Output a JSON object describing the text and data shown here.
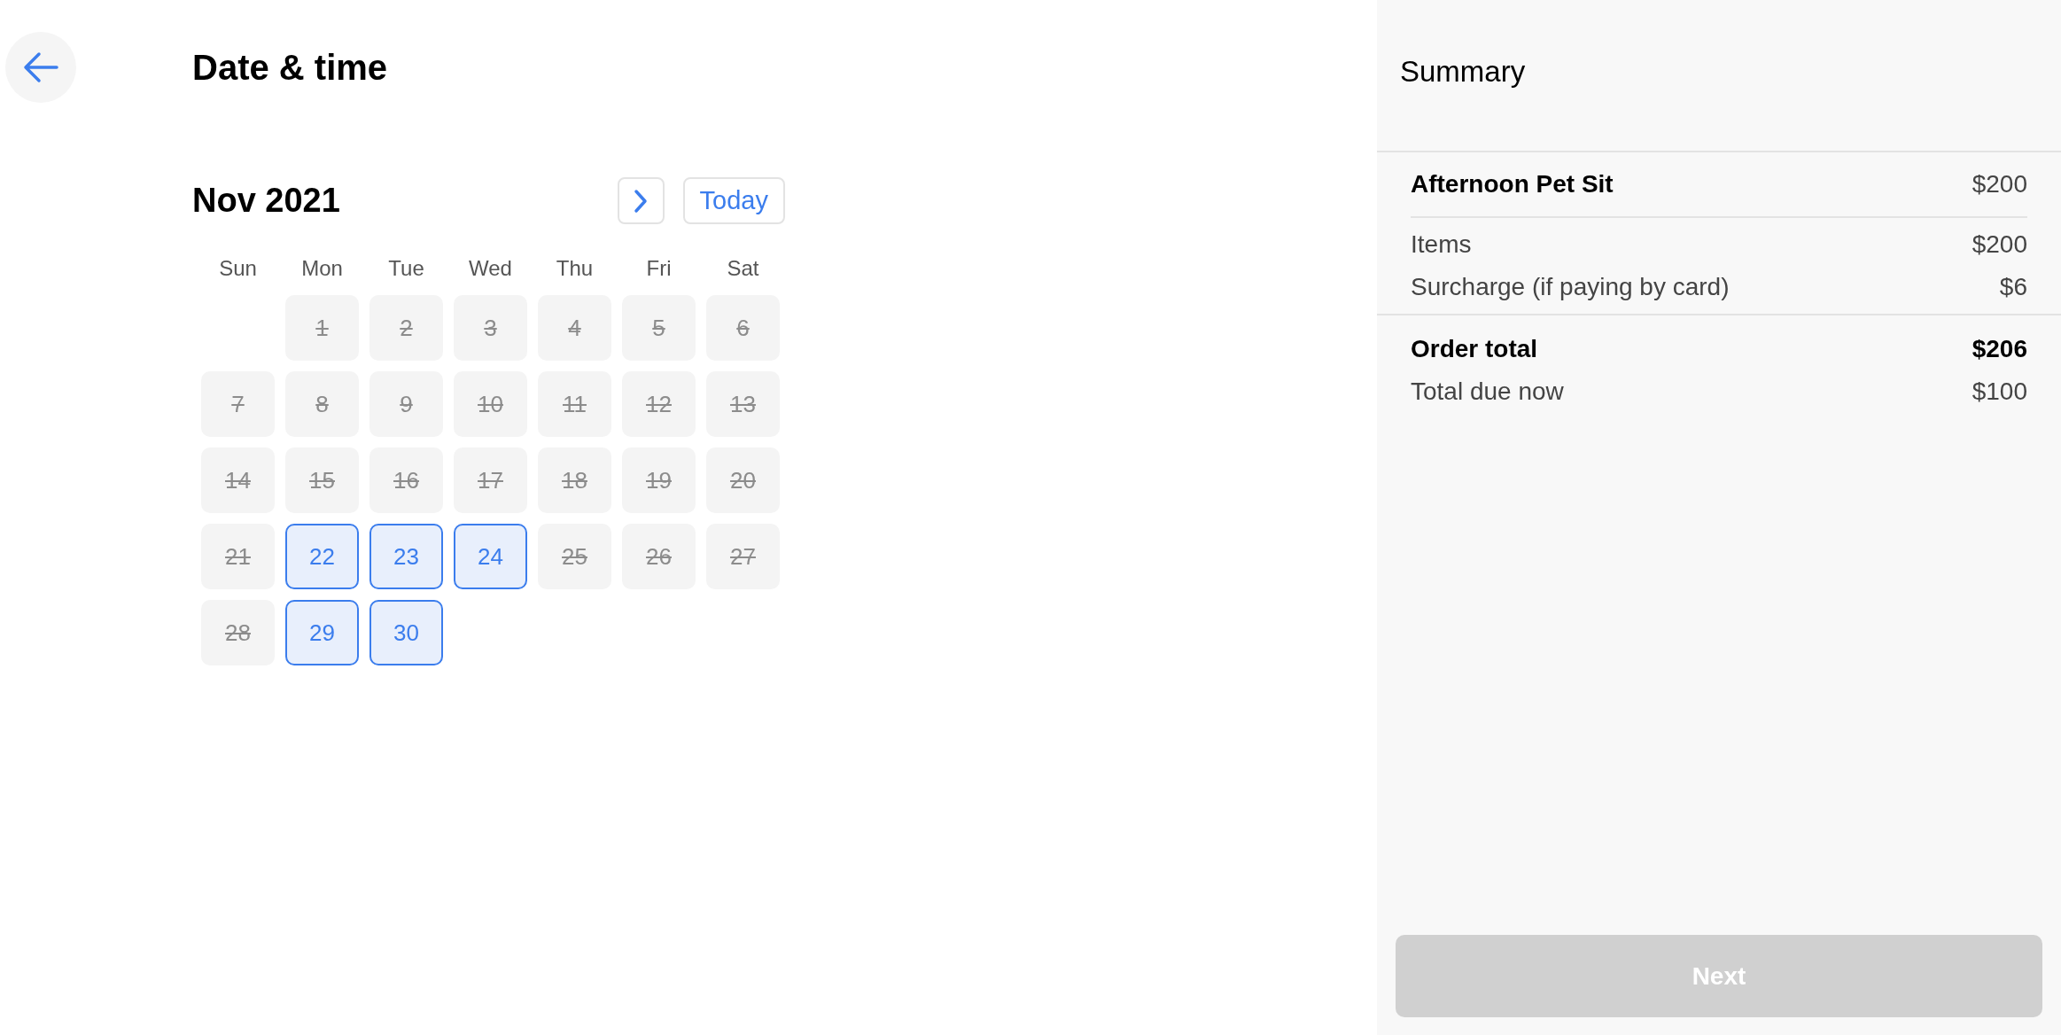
{
  "header": {
    "title": "Date & time"
  },
  "calendar": {
    "month": "Nov 2021",
    "today_button": "Today",
    "weekdays": [
      "Sun",
      "Mon",
      "Tue",
      "Wed",
      "Thu",
      "Fri",
      "Sat"
    ],
    "weeks": [
      [
        {
          "day": "1",
          "available": false
        },
        {
          "day": "2",
          "available": false
        },
        {
          "day": "3",
          "available": false
        },
        {
          "day": "4",
          "available": false
        },
        {
          "day": "5",
          "available": false
        },
        {
          "day": "6",
          "available": false
        }
      ],
      [
        {
          "day": "7",
          "available": false
        },
        {
          "day": "8",
          "available": false
        },
        {
          "day": "9",
          "available": false
        },
        {
          "day": "10",
          "available": false
        },
        {
          "day": "11",
          "available": false
        },
        {
          "day": "12",
          "available": false
        },
        {
          "day": "13",
          "available": false
        }
      ],
      [
        {
          "day": "14",
          "available": false
        },
        {
          "day": "15",
          "available": false
        },
        {
          "day": "16",
          "available": false
        },
        {
          "day": "17",
          "available": false
        },
        {
          "day": "18",
          "available": false
        },
        {
          "day": "19",
          "available": false
        },
        {
          "day": "20",
          "available": false
        }
      ],
      [
        {
          "day": "21",
          "available": false
        },
        {
          "day": "22",
          "available": true
        },
        {
          "day": "23",
          "available": true
        },
        {
          "day": "24",
          "available": true
        },
        {
          "day": "25",
          "available": false
        },
        {
          "day": "26",
          "available": false
        },
        {
          "day": "27",
          "available": false
        }
      ],
      [
        {
          "day": "28",
          "available": false
        },
        {
          "day": "29",
          "available": true
        },
        {
          "day": "30",
          "available": true
        }
      ]
    ]
  },
  "summary": {
    "title": "Summary",
    "service": {
      "label": "Afternoon Pet Sit",
      "amount": "$200"
    },
    "lines": [
      {
        "label": "Items",
        "amount": "$200"
      },
      {
        "label": "Surcharge (if paying by card)",
        "amount": "$6"
      }
    ],
    "totals": [
      {
        "label": "Order total",
        "amount": "$206",
        "kind": "bold"
      },
      {
        "label": "Total due now",
        "amount": "$100",
        "kind": "plain"
      }
    ],
    "next_button": {
      "label": "Next",
      "disabled": true
    }
  }
}
